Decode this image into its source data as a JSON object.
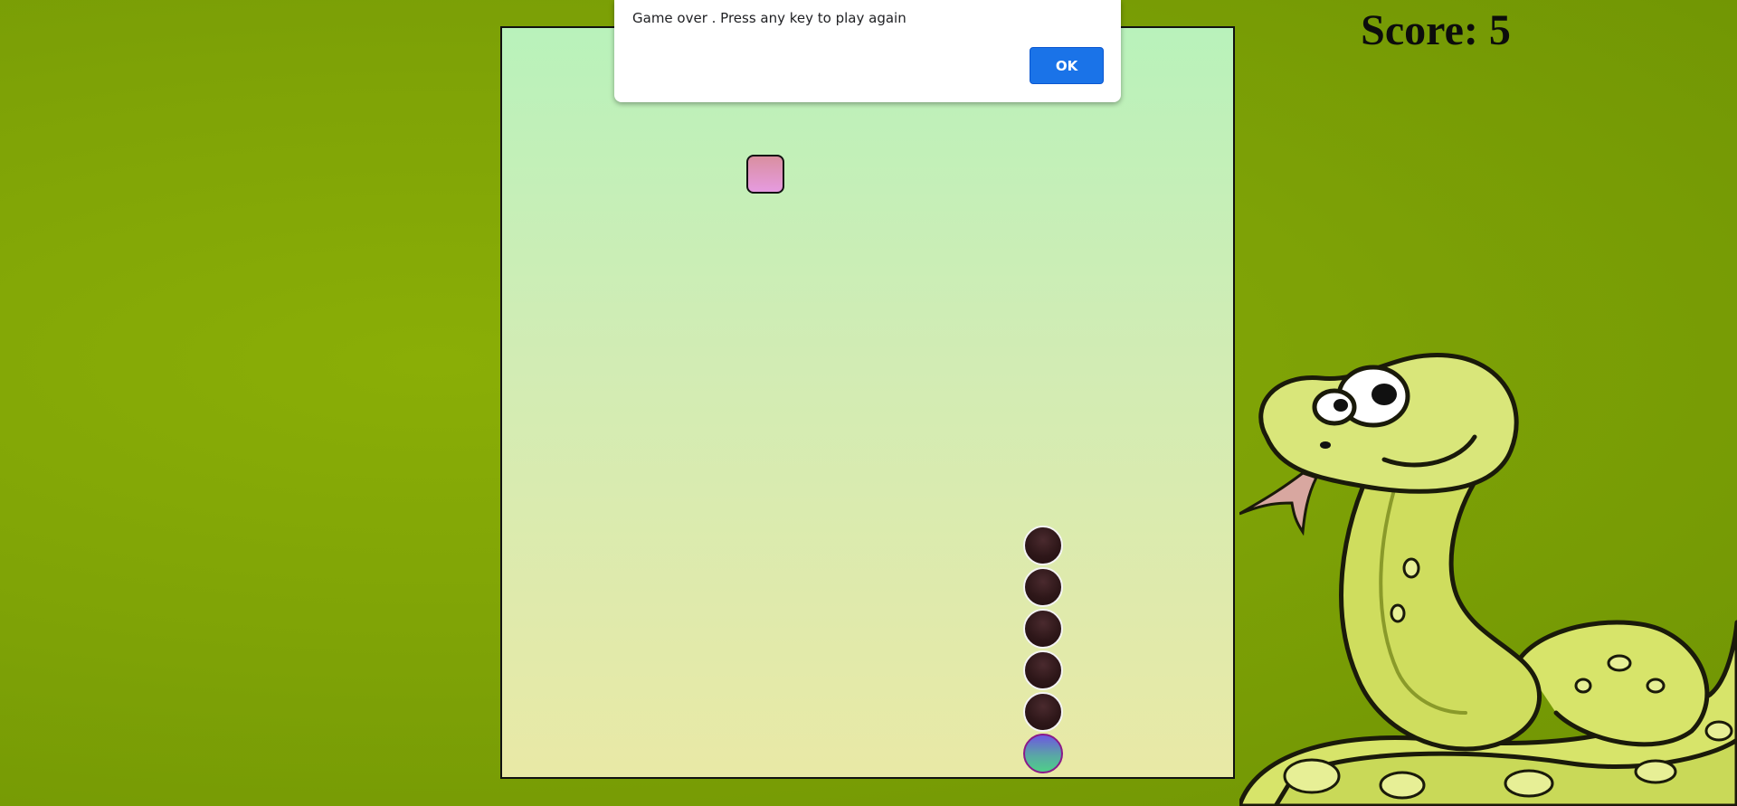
{
  "game": {
    "score_label": "Score:",
    "score": 5,
    "snake": {
      "head": {
        "col": 13,
        "row": 17
      },
      "body": [
        {
          "col": 13,
          "row": 16
        },
        {
          "col": 13,
          "row": 15
        },
        {
          "col": 13,
          "row": 14
        },
        {
          "col": 13,
          "row": 13
        },
        {
          "col": 13,
          "row": 12
        }
      ]
    },
    "food": {
      "col": 6,
      "row": 4
    }
  },
  "dialog": {
    "message": "Game over . Press any key to play again",
    "ok_label": "OK"
  },
  "colors": {
    "background": "#7fa306",
    "board_top": "#b9f2bb",
    "board_bottom": "#e9e9a6",
    "ok_button": "#1a73e8",
    "food": "#e69be0",
    "snake_body": "#2e1719"
  },
  "icons": {
    "mascot": "cartoon-snake-icon"
  }
}
